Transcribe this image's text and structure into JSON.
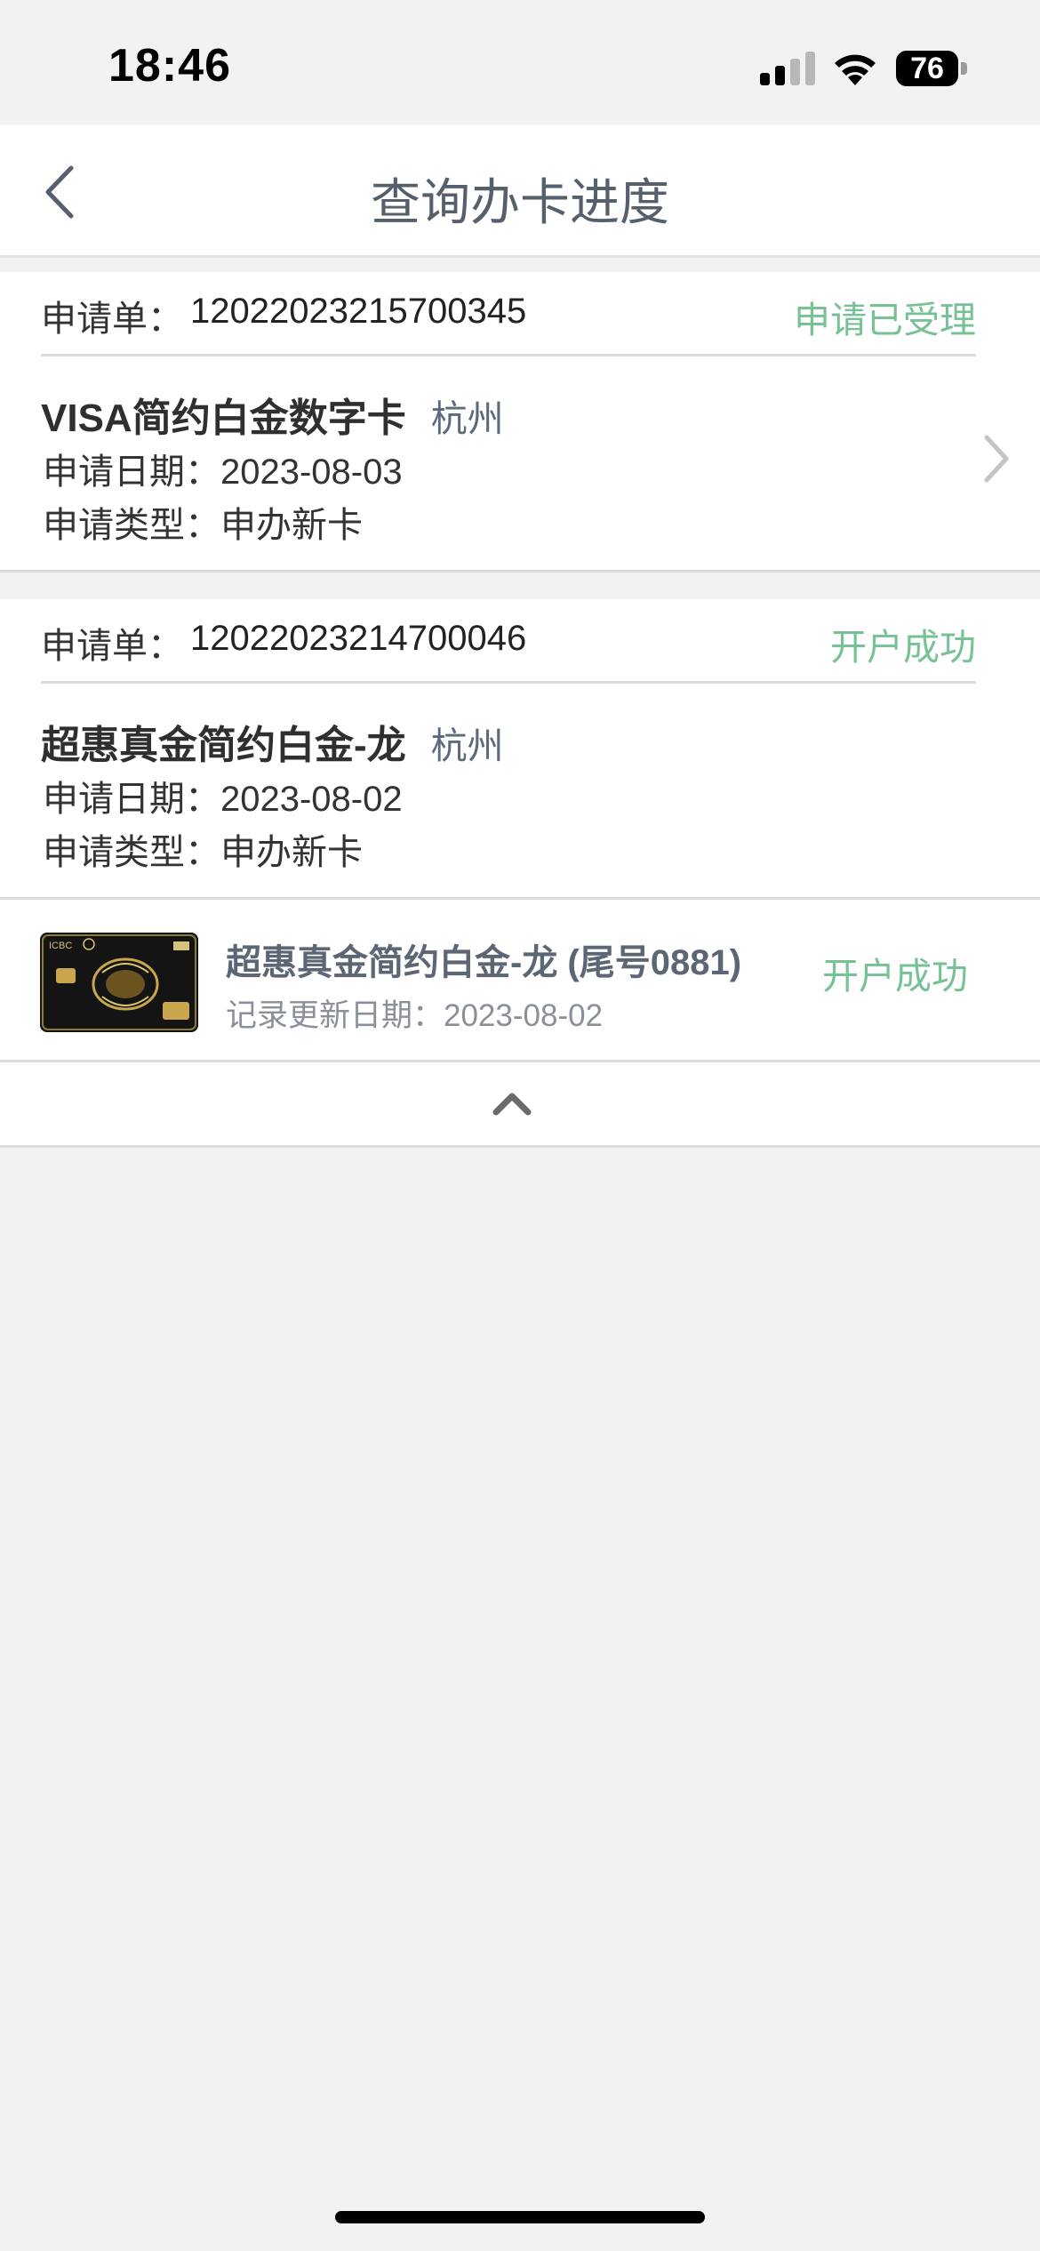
{
  "status_bar": {
    "time": "18:46",
    "battery": "76"
  },
  "nav": {
    "title": "查询办卡进度",
    "back_icon": "chevron-left-icon"
  },
  "applications": [
    {
      "order_label": "申请单：",
      "order_number": "12022023215700345",
      "status": "申请已受理",
      "card_name": "VISA简约白金数字卡",
      "city": "杭州",
      "date_line": "申请日期：2023-08-03",
      "type_line": "申请类型：申办新卡"
    },
    {
      "order_label": "申请单：",
      "order_number": "12022023214700046",
      "status": "开户成功",
      "card_name": "超惠真金简约白金-龙",
      "city": "杭州",
      "date_line": "申请日期：2023-08-02",
      "type_line": "申请类型：申办新卡"
    }
  ],
  "issued_card": {
    "name": "超惠真金简约白金-龙 (尾号0881)",
    "update_line": "记录更新日期：2023-08-02",
    "status": "开户成功",
    "card_brand_text": "ICBC"
  },
  "colors": {
    "success_green": "#76c295",
    "title_gray": "#56606d",
    "city_blue_gray": "#5d6a7c"
  }
}
